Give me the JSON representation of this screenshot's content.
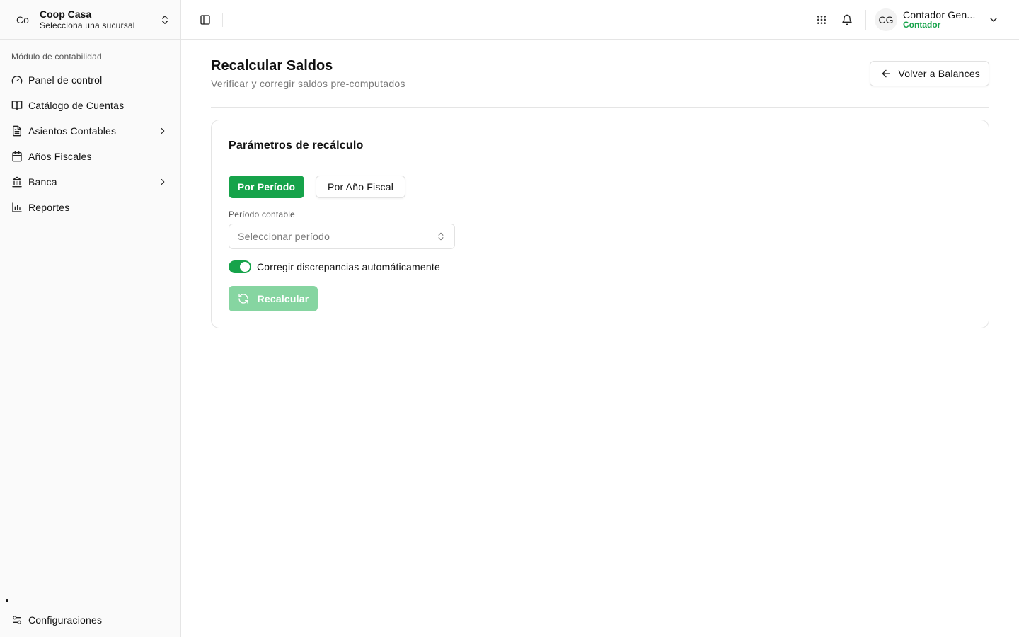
{
  "org": {
    "avatar": "Co",
    "name": "Coop Casa",
    "subtitle": "Selecciona una sucursal"
  },
  "sidebar": {
    "section_label": "Módulo de contabilidad",
    "items": [
      {
        "label": "Panel de control",
        "icon": "gauge-icon",
        "has_children": false
      },
      {
        "label": "Catálogo de Cuentas",
        "icon": "book-open-icon",
        "has_children": false
      },
      {
        "label": "Asientos Contables",
        "icon": "file-text-icon",
        "has_children": true
      },
      {
        "label": "Años Fiscales",
        "icon": "calendar-icon",
        "has_children": false
      },
      {
        "label": "Banca",
        "icon": "bank-icon",
        "has_children": true
      },
      {
        "label": "Reportes",
        "icon": "bar-chart-icon",
        "has_children": false
      }
    ],
    "settings_label": "Configuraciones"
  },
  "user": {
    "initials": "CG",
    "name": "Contador Gen...",
    "role": "Contador"
  },
  "page": {
    "title": "Recalcular Saldos",
    "subtitle": "Verificar y corregir saldos pre-computados",
    "back_label": "Volver a Balances"
  },
  "form": {
    "card_title": "Parámetros de recálculo",
    "modes": [
      "Por Período",
      "Por Año Fiscal"
    ],
    "active_mode": "Por Período",
    "period_label": "Período contable",
    "period_placeholder": "Seleccionar período",
    "auto_fix_label": "Corregir discrepancias automáticamente",
    "auto_fix_enabled": true,
    "submit_label": "Recalcular",
    "submit_disabled": true
  },
  "colors": {
    "accent": "#16a34a",
    "accent_disabled": "#86d5a1",
    "sidebar_bg": "#fafafa",
    "border": "#e5e5e5"
  }
}
